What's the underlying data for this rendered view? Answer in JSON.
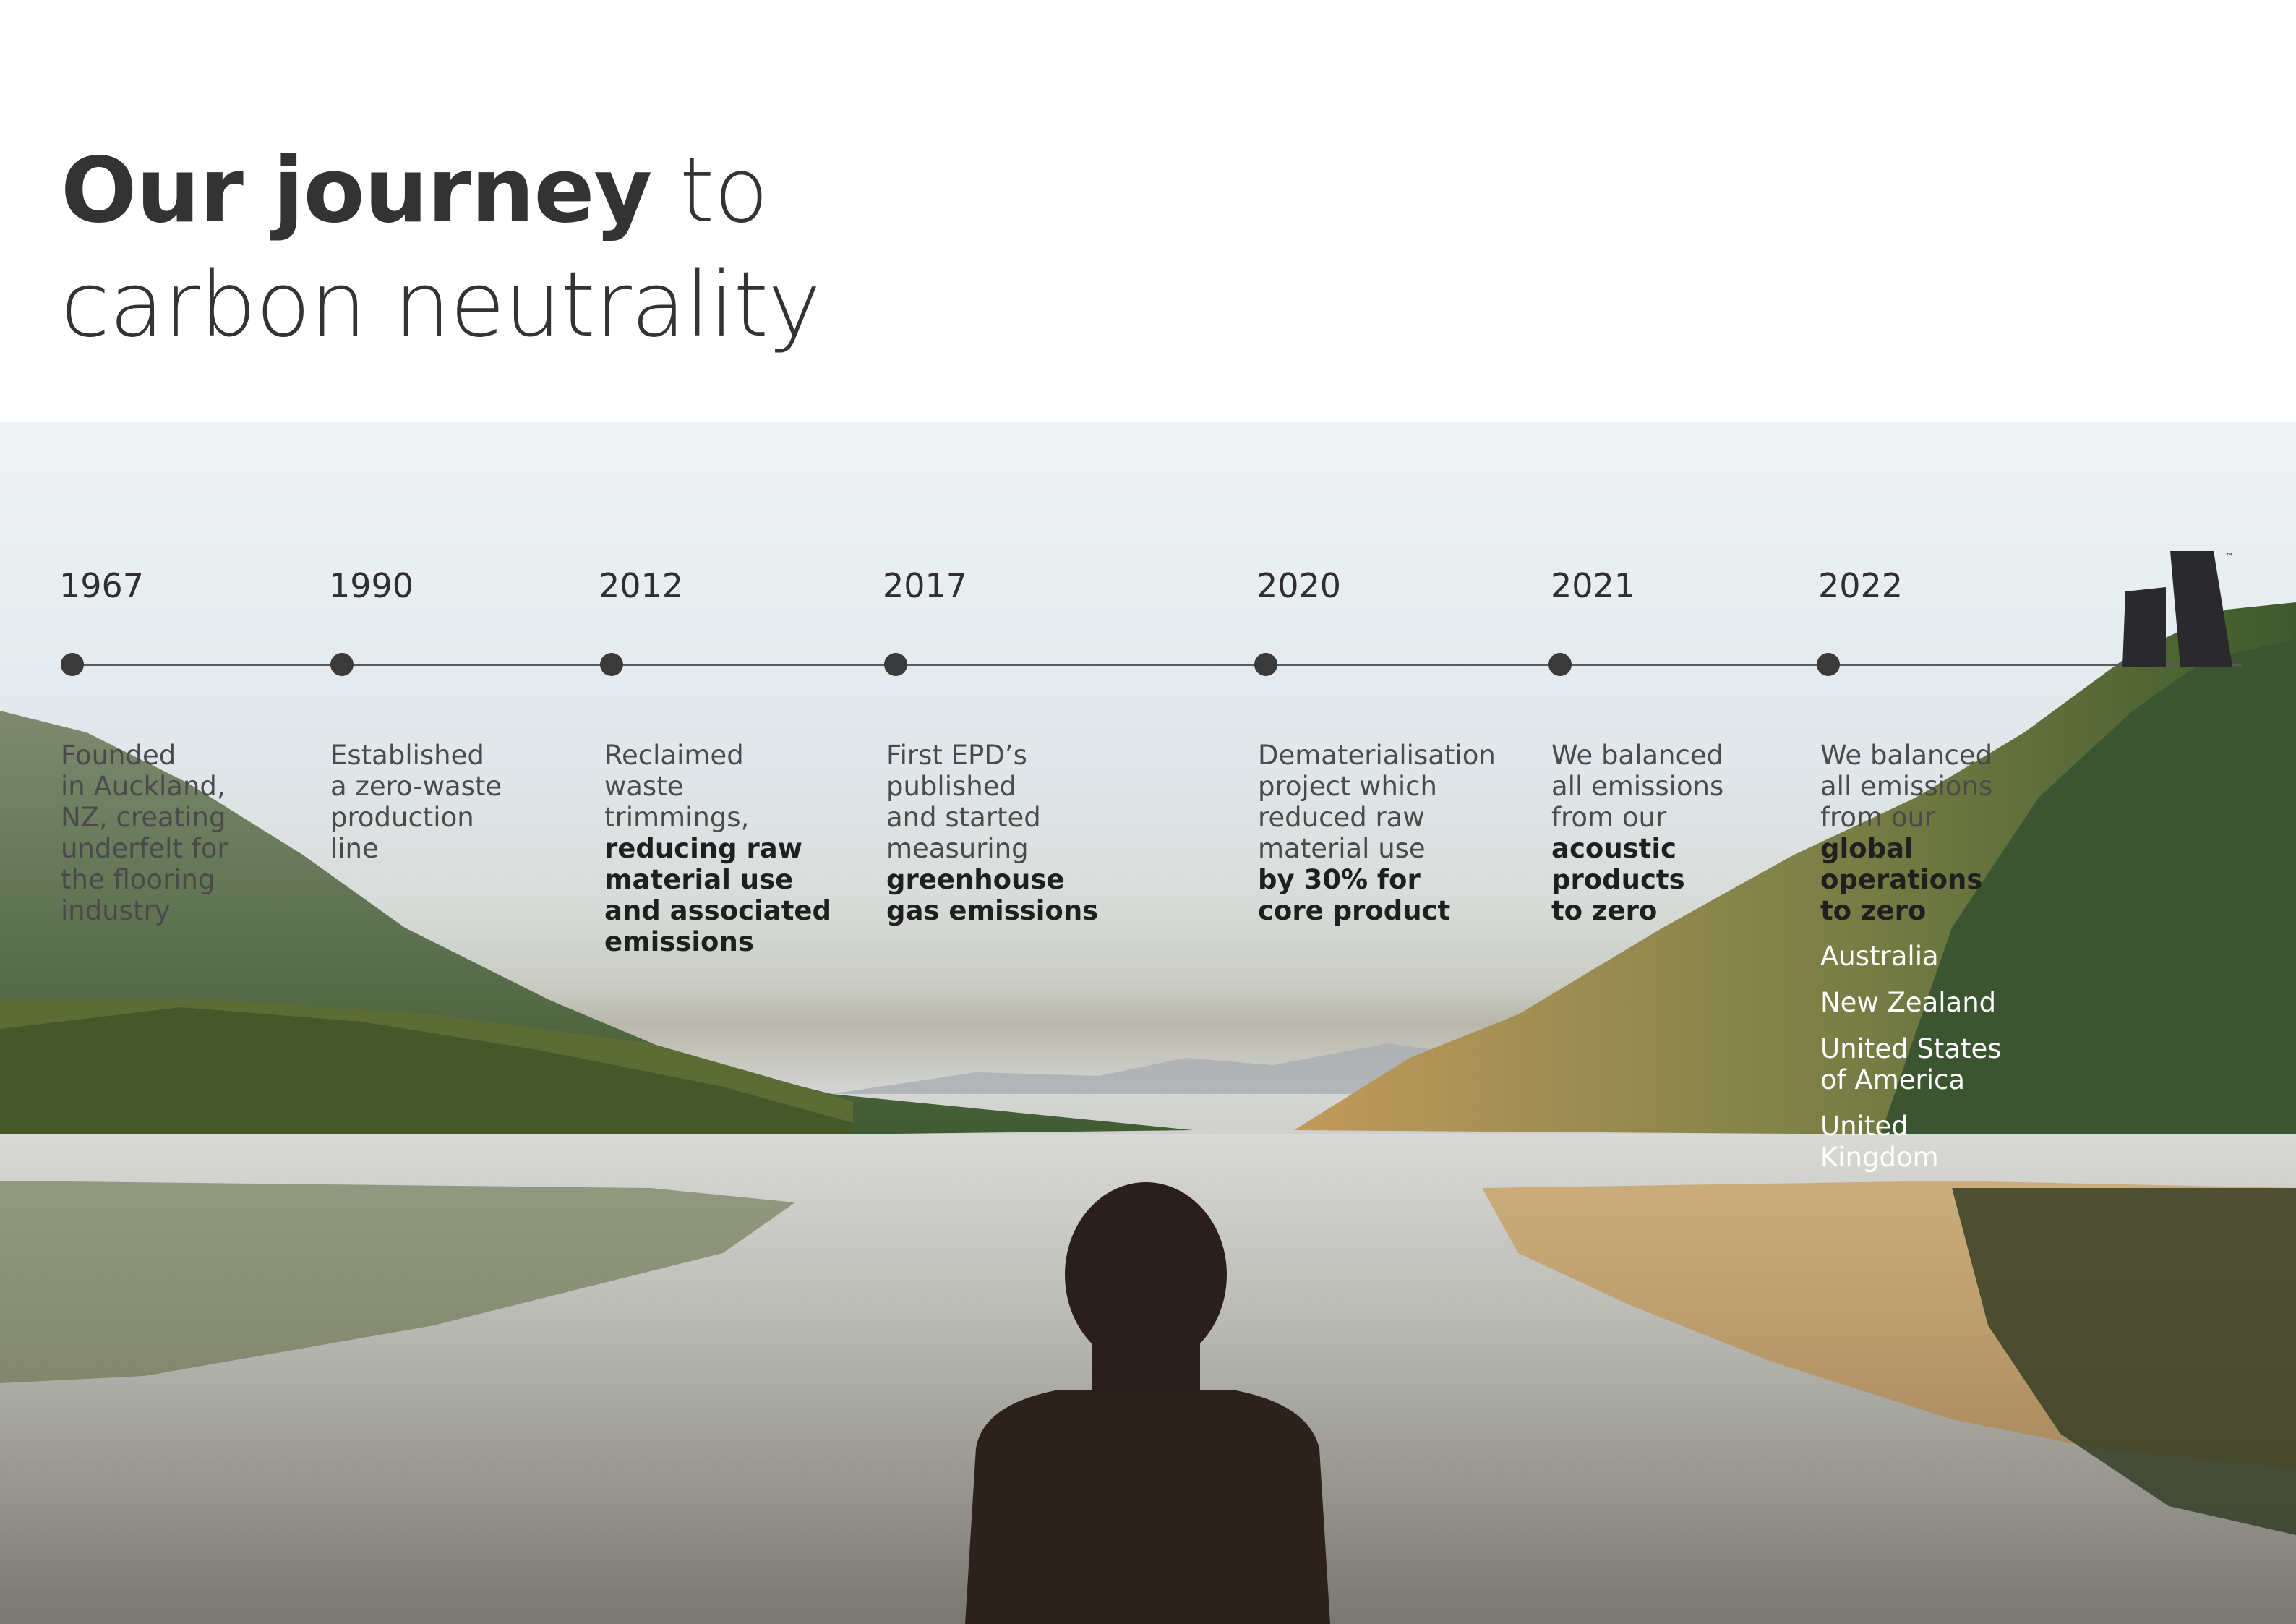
{
  "title": {
    "line1_bold": "Our journey",
    "line1_rest": " to",
    "line2": "carbon neutrality"
  },
  "timeline": [
    {
      "year": "1967",
      "normal": [
        "Founded",
        "in Auckland,",
        "NZ, creating",
        "underfelt for",
        "the flooring",
        "industry"
      ],
      "bold": []
    },
    {
      "year": "1990",
      "normal": [
        "Established",
        "a zero-waste",
        "production",
        "line"
      ],
      "bold": []
    },
    {
      "year": "2012",
      "normal": [
        "Reclaimed",
        "waste",
        "trimmings,"
      ],
      "bold": [
        "reducing raw",
        "material use",
        "and associated",
        "emissions"
      ]
    },
    {
      "year": "2017",
      "normal": [
        "First EPD’s",
        "published",
        "and started",
        "measuring"
      ],
      "bold": [
        "greenhouse",
        "gas emissions"
      ]
    },
    {
      "year": "2020",
      "normal": [
        "Dematerialisation",
        "project which",
        "reduced raw",
        "material use"
      ],
      "bold": [
        "by 30% for",
        "core product"
      ]
    },
    {
      "year": "2021",
      "normal": [
        "We balanced",
        "all emissions",
        "from our"
      ],
      "bold": [
        "acoustic",
        "products",
        "to zero"
      ]
    },
    {
      "year": "2022",
      "normal": [
        "We balanced",
        "all emissions",
        "from our"
      ],
      "bold": [
        "global",
        "operations",
        "to zero"
      ]
    }
  ],
  "countries": [
    {
      "lines": [
        "Australia"
      ]
    },
    {
      "lines": [
        "New Zealand"
      ]
    },
    {
      "lines": [
        "United States",
        "of America"
      ]
    },
    {
      "lines": [
        "United",
        "Kingdom"
      ]
    }
  ],
  "logo": {
    "icon": "brand-logo-icon",
    "trademark": "™",
    "color": "#2a2a2d"
  },
  "colors": {
    "text_dark": "#333333",
    "timeline": "#3a3a3a",
    "country_text": "#ffffff"
  }
}
